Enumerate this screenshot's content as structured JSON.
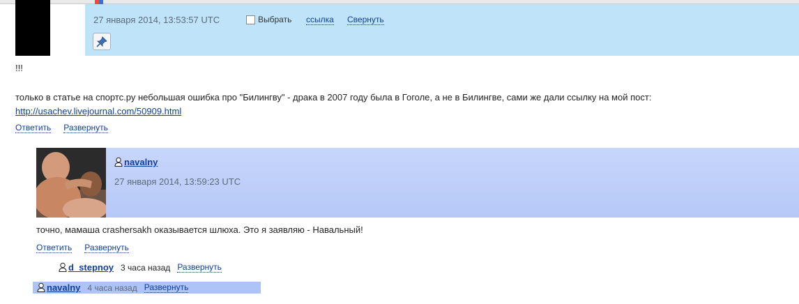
{
  "comment1": {
    "date": "27 января 2014, 13:53:57 UTC",
    "select_label": "Выбрать",
    "link_label": "ссылка",
    "collapse_label": "Свернуть",
    "text1": "!!!",
    "text2": "только в статье на спортс.ру небольшая ошибка про \"Билингву\" - драка в 2007 году была в Гоголе, а не в Билингве, сами же дали ссылку на мой пост: ",
    "url": "http://usachev.livejournal.com/50909.html",
    "reply_label": "Ответить",
    "expand_label": "Развернуть"
  },
  "comment2": {
    "username": "navalny",
    "date": "27 января 2014, 13:59:23 UTC",
    "text": "точно, мамаша crashersakh оказывается шлюха. Это я заявляю - Навальный!",
    "reply_label": "Ответить",
    "expand_label": "Развернуть"
  },
  "reply1": {
    "username": "d_stepnoy",
    "time_ago": "3 часа назад",
    "expand_label": "Развернуть"
  },
  "reply2": {
    "username": "navalny",
    "time_ago": "4 часа назад",
    "expand_label": "Развернуть"
  },
  "colors": {
    "comment1_header": "#bfe3f8",
    "comment2_header": "#b6c8f7",
    "reply2_bg": "#aec3f6",
    "link": "#0e3e9d"
  }
}
